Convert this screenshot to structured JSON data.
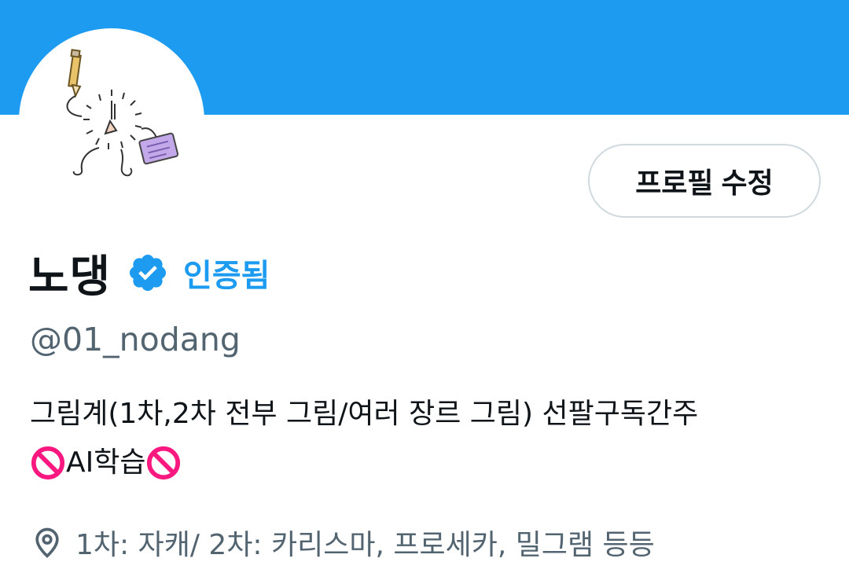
{
  "colors": {
    "banner": "#1d9bf0",
    "accent": "#1d9bf0",
    "text_primary": "#0f1419",
    "text_secondary": "#536471",
    "border": "#cfd9de",
    "prohibited": "#f91880"
  },
  "profile": {
    "avatar_icon": "avatar-drawing",
    "edit_button_label": "프로필 수정",
    "display_name": "노댕",
    "verified_badge_icon": "verified-badge-icon",
    "verified_label": "인증됨",
    "handle": "@01_nodang",
    "bio": {
      "line1": "그림계(1차,2차 전부 그림/여러 장르 그림) 선팔구독간주",
      "line2_text": "AI학습",
      "line2_icons": [
        "no-entry-icon",
        "no-entry-icon"
      ]
    },
    "location_icon": "location-pin-icon",
    "location": "1차: 자캐/ 2차: 카리스마, 프로세카, 밀그램 등등"
  }
}
